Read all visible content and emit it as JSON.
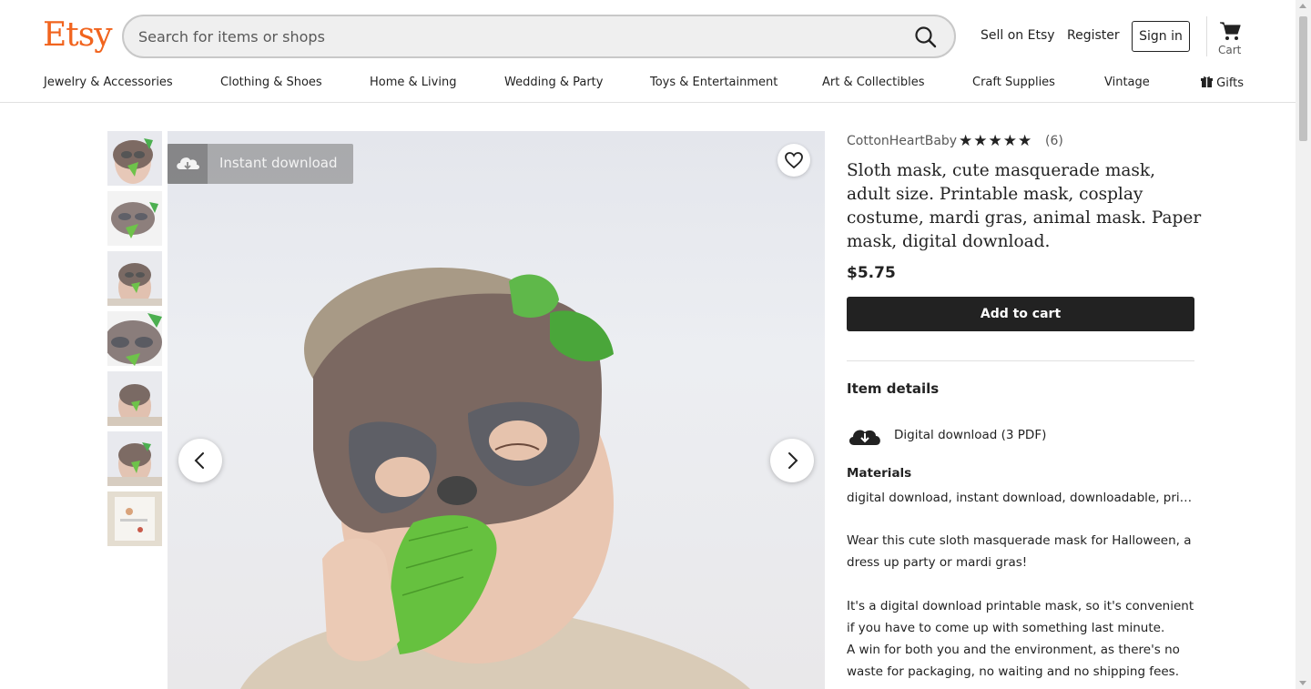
{
  "header": {
    "logo": "Etsy",
    "search_placeholder": "Search for items or shops",
    "links": {
      "sell": "Sell on Etsy",
      "register": "Register",
      "signin": "Sign in",
      "cart": "Cart"
    }
  },
  "nav": {
    "items": [
      "Jewelry & Accessories",
      "Clothing & Shoes",
      "Home & Living",
      "Wedding & Party",
      "Toys & Entertainment",
      "Art & Collectibles",
      "Craft Supplies",
      "Vintage",
      "Gifts"
    ]
  },
  "gallery": {
    "badge": "Instant download",
    "thumbnail_count": 7
  },
  "listing": {
    "shop": "CottonHeartBaby",
    "stars": "★★★★★",
    "rating": 5,
    "review_count": "(6)",
    "title": "Sloth mask, cute masquerade mask, adult size. Printable mask, cosplay costume, mardi gras, animal mask. Paper mask, digital download.",
    "price": "$5.75",
    "add_to_cart": "Add to cart"
  },
  "details": {
    "section_title": "Item details",
    "download": "Digital download (3 PDF)",
    "materials_title": "Materials",
    "materials": "digital download, instant download, downloadable, printable, paper",
    "description": [
      "Wear this cute sloth masquerade mask for Halloween, a dress up party or mardi gras!",
      "It's a digital download printable mask, so it's convenient if you have to come up with something last minute.",
      "A win for both you and the environment, as there's no waste for packaging, no waiting and no shipping fees."
    ]
  },
  "colors": {
    "brand": "#f1641e",
    "button": "#222222"
  }
}
